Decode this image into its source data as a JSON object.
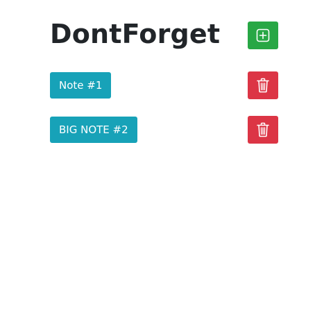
{
  "header": {
    "title": "DontForget",
    "add_button_icon": "plus-square-icon"
  },
  "notes": [
    {
      "label": "Note #1",
      "delete_icon": "trash-icon"
    },
    {
      "label": "BIG NOTE #2",
      "delete_icon": "trash-icon"
    }
  ],
  "colors": {
    "add": "#28a745",
    "delete": "#dc3545",
    "note": "#17a2b8",
    "title": "#212529"
  }
}
